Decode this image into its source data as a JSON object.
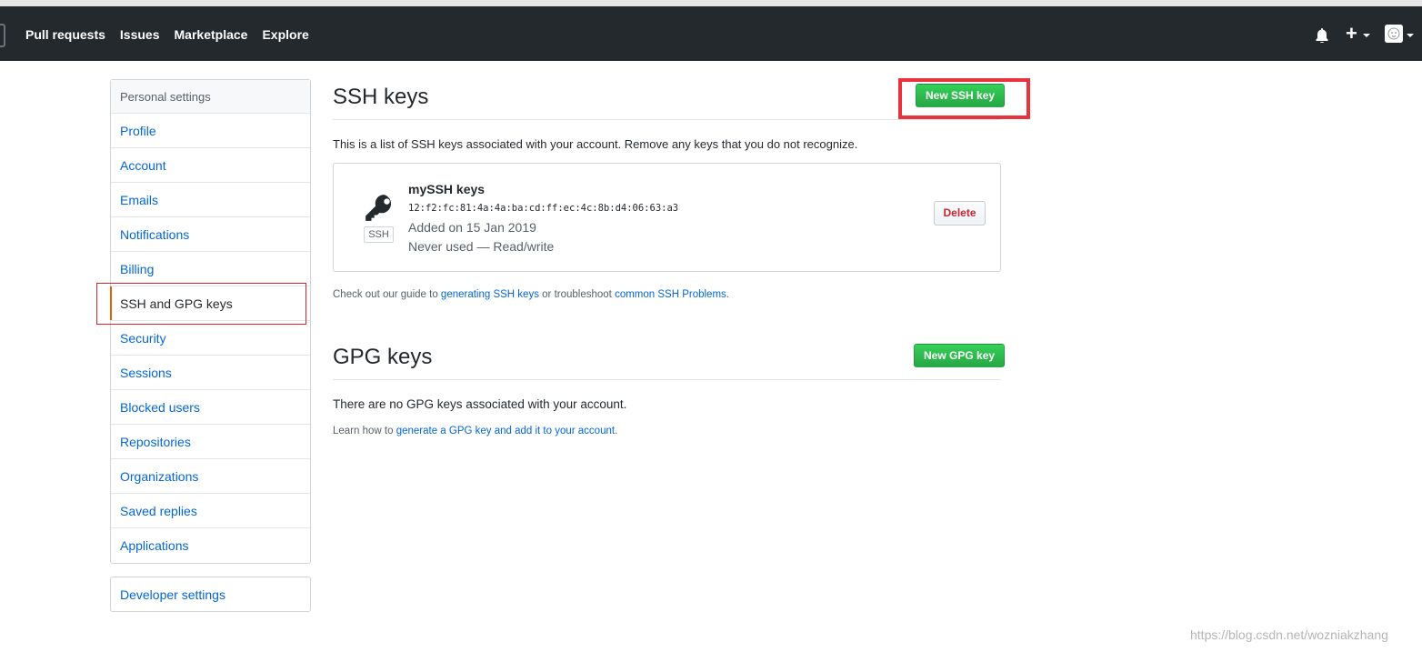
{
  "header": {
    "nav": [
      "Pull requests",
      "Issues",
      "Marketplace",
      "Explore"
    ]
  },
  "sidebar": {
    "heading": "Personal settings",
    "items": [
      {
        "label": "Profile"
      },
      {
        "label": "Account"
      },
      {
        "label": "Emails"
      },
      {
        "label": "Notifications"
      },
      {
        "label": "Billing"
      },
      {
        "label": "SSH and GPG keys",
        "selected": true
      },
      {
        "label": "Security"
      },
      {
        "label": "Sessions"
      },
      {
        "label": "Blocked users"
      },
      {
        "label": "Repositories"
      },
      {
        "label": "Organizations"
      },
      {
        "label": "Saved replies"
      },
      {
        "label": "Applications"
      }
    ],
    "developer_settings": "Developer settings"
  },
  "ssh": {
    "title": "SSH keys",
    "new_button": "New SSH key",
    "description": "This is a list of SSH keys associated with your account. Remove any keys that you do not recognize.",
    "keys": [
      {
        "title": "mySSH keys",
        "fingerprint": "12:f2:fc:81:4a:4a:ba:cd:ff:ec:4c:8b:d4:06:63:a3",
        "added": "Added on 15 Jan 2019",
        "usage": "Never used — Read/write",
        "badge": "SSH",
        "delete_label": "Delete"
      }
    ],
    "guide": {
      "prefix": "Check out our guide to ",
      "link1": "generating SSH keys",
      "middle": " or troubleshoot ",
      "link2": "common SSH Problems",
      "suffix": "."
    }
  },
  "gpg": {
    "title": "GPG keys",
    "new_button": "New GPG key",
    "empty_text": "There are no GPG keys associated with your account.",
    "learn": {
      "prefix": "Learn how to ",
      "link": "generate a GPG key and add it to your account",
      "suffix": "."
    }
  },
  "watermark": "https://blog.csdn.net/wozniakzhang",
  "colors": {
    "header_bg": "#24292e",
    "link": "#0366d6",
    "green": "#28a745",
    "danger": "#cb2431",
    "highlight": "#e8333c"
  }
}
